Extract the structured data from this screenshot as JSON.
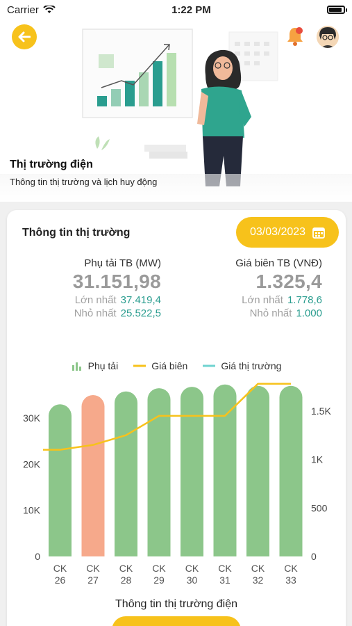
{
  "status": {
    "carrier": "Carrier",
    "time": "1:22 PM"
  },
  "header": {
    "title": "Thị trường điện",
    "subtitle": "Thông tin thị trường và lịch huy động"
  },
  "market": {
    "title": "Thông tin thị trường",
    "date": "03/03/2023",
    "load": {
      "label": "Phụ tải TB (MW)",
      "value": "31.151,98",
      "max_label": "Lớn nhất",
      "max": "37.419,4",
      "min_label": "Nhỏ nhất",
      "min": "25.522,5"
    },
    "price": {
      "label": "Giá biên TB (VNĐ)",
      "value": "1.325,4",
      "max_label": "Lớn nhất",
      "max": "1.778,6",
      "min_label": "Nhỏ nhất",
      "min": "1.000"
    }
  },
  "legend": {
    "load": "Phụ tải",
    "marginal": "Giá biên",
    "market": "Giá thị trường"
  },
  "colors": {
    "accent": "#f7c21b",
    "bar": "#8cc68a",
    "bar_highlight": "#f6a98b",
    "line": "#f7c21b",
    "market_line": "#6fd3d0",
    "teal": "#2a9d8f"
  },
  "chart_data": {
    "type": "bar",
    "categories": [
      "CK 26",
      "CK 27",
      "CK 28",
      "CK 29",
      "CK 30",
      "CK 31",
      "CK 32",
      "CK 33"
    ],
    "series": [
      {
        "name": "Phụ tải",
        "type": "bar",
        "axis": "left",
        "values": [
          33000,
          35000,
          35800,
          36500,
          36800,
          37300,
          37000,
          37000
        ]
      },
      {
        "name": "Giá biên",
        "type": "line",
        "axis": "right",
        "values": [
          1100,
          1150,
          1250,
          1450,
          1450,
          1450,
          1780,
          1780
        ]
      },
      {
        "name": "Giá thị trường",
        "type": "line",
        "axis": "right",
        "values": []
      }
    ],
    "highlight_index": 1,
    "y_left": {
      "ticks": [
        "0",
        "10K",
        "20K",
        "30K"
      ],
      "ylim": [
        0,
        37419.4
      ]
    },
    "y_right": {
      "ticks": [
        "0",
        "500",
        "1K",
        "1.5K"
      ],
      "ylim": [
        0,
        1778.6
      ]
    }
  },
  "footer": {
    "title": "Thông tin thị trường điện"
  }
}
